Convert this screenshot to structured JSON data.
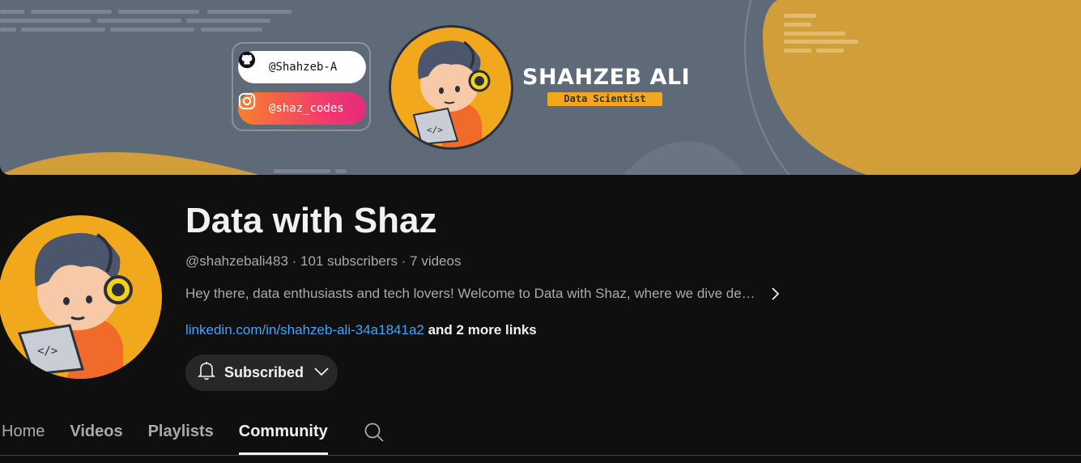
{
  "banner": {
    "github_handle": "@Shahzeb-A",
    "instagram_handle": "@shaz_codes",
    "name": "SHAHZEB ALI",
    "role": "Data Scientist",
    "colors": {
      "background": "#5f6a78",
      "accent": "#f2a81d"
    }
  },
  "channel": {
    "title": "Data with Shaz",
    "handle": "@shahzebali483",
    "subscribers": "101 subscribers",
    "videos": "7 videos",
    "separator": " · ",
    "description": "Hey there, data enthusiasts and tech lovers! Welcome to Data with Shaz, where we dive de…",
    "link": "linkedin.com/in/shahzeb-ali-34a1841a2",
    "more_links": " and 2 more links"
  },
  "subscribe_button": {
    "label": "Subscribed",
    "icon": "bell-icon"
  },
  "tabs": [
    {
      "label": "Home"
    },
    {
      "label": "Videos"
    },
    {
      "label": "Playlists"
    },
    {
      "label": "Community",
      "active": true
    }
  ],
  "search_icon": "search-icon",
  "colors": {
    "link": "#3ea6ff",
    "page_bg": "#0f0f0f",
    "button_bg": "#272727"
  }
}
